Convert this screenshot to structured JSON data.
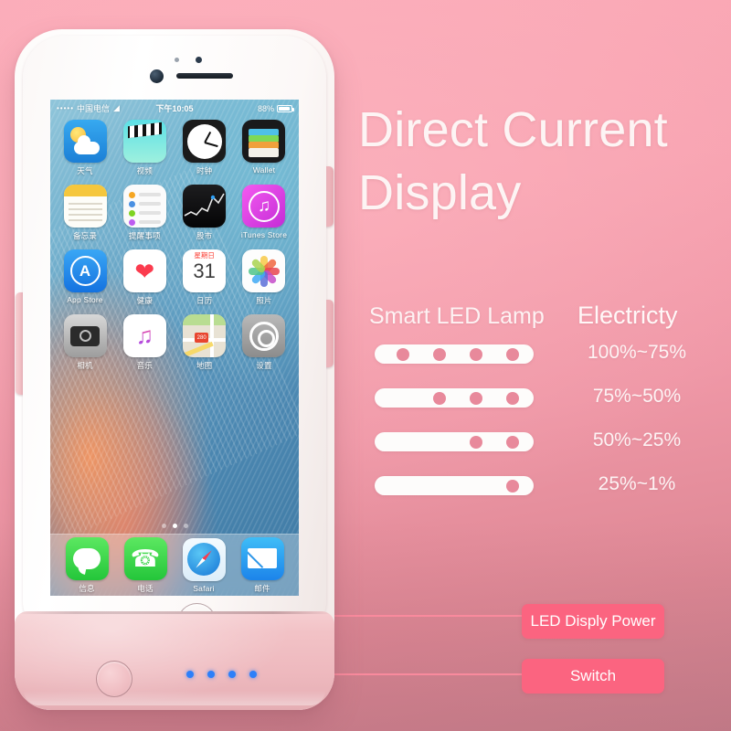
{
  "headline": {
    "line1": "Direct Current",
    "line2": "Display"
  },
  "legend": {
    "lamp_header": "Smart LED Lamp",
    "electricity_header": "Electricty",
    "rows": [
      {
        "lit": 4,
        "total": 4,
        "percent": "100%~75%"
      },
      {
        "lit": 3,
        "total": 4,
        "percent": "75%~50%"
      },
      {
        "lit": 2,
        "total": 4,
        "percent": "50%~25%"
      },
      {
        "lit": 1,
        "total": 4,
        "percent": "25%~1%"
      }
    ]
  },
  "callouts": {
    "led_power": "LED Disply Power",
    "switch": "Switch"
  },
  "phone": {
    "status_bar": {
      "signal_dots": "•••••",
      "carrier": "中国电信",
      "wifi": "wifi-icon",
      "time": "下午10:05",
      "battery_percent": "88%"
    },
    "apps": [
      [
        {
          "label": "天气",
          "icon": "weather-icon"
        },
        {
          "label": "视频",
          "icon": "videos-icon"
        },
        {
          "label": "时钟",
          "icon": "clock-icon"
        },
        {
          "label": "Wallet",
          "icon": "wallet-icon"
        }
      ],
      [
        {
          "label": "备忘录",
          "icon": "notes-icon"
        },
        {
          "label": "提醒事项",
          "icon": "reminders-icon"
        },
        {
          "label": "股市",
          "icon": "stocks-icon"
        },
        {
          "label": "iTunes Store",
          "icon": "itunes-store-icon"
        }
      ],
      [
        {
          "label": "App Store",
          "icon": "app-store-icon"
        },
        {
          "label": "健康",
          "icon": "health-icon"
        },
        {
          "label": "日历",
          "icon": "calendar-icon"
        },
        {
          "label": "照片",
          "icon": "photos-icon"
        }
      ],
      [
        {
          "label": "相机",
          "icon": "camera-icon"
        },
        {
          "label": "音乐",
          "icon": "music-icon"
        },
        {
          "label": "地图",
          "icon": "maps-icon"
        },
        {
          "label": "设置",
          "icon": "settings-icon"
        }
      ]
    ],
    "calendar_icon": {
      "weekday": "星期日",
      "day": "31"
    },
    "maps_icon": {
      "route_shield": "280"
    },
    "dock": [
      {
        "label": "信息",
        "icon": "messages-icon"
      },
      {
        "label": "电话",
        "icon": "phone-icon"
      },
      {
        "label": "Safari",
        "icon": "safari-icon"
      },
      {
        "label": "邮件",
        "icon": "mail-icon"
      }
    ],
    "page_dots": 3,
    "active_page": 1
  },
  "battery_case": {
    "led_count": 4
  },
  "colors": {
    "background_top": "#fbabb8",
    "background_bottom": "#c9808c",
    "badge": "#fb6480",
    "leader_line": "#f98a9d",
    "led_dot": "#e8899b",
    "case_rose_gold": "#f0bfc4",
    "blue_led": "#2d7ff9",
    "text_white": "#fdf4f4"
  }
}
